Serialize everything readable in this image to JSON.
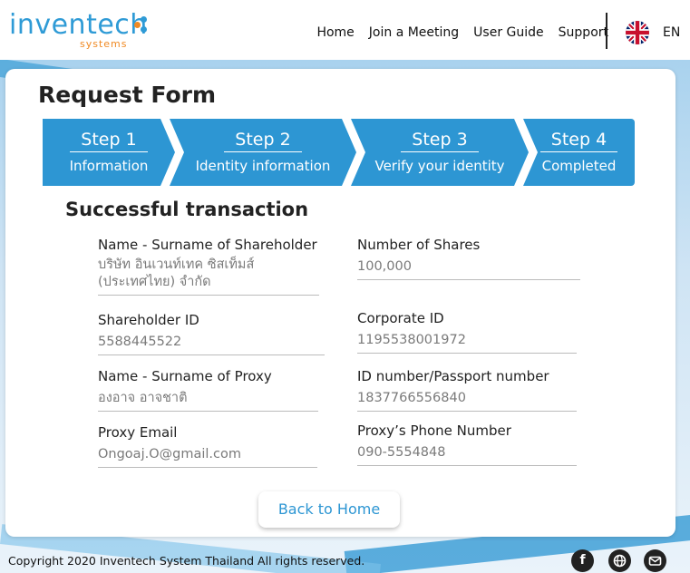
{
  "header": {
    "logo_text": "inventech",
    "logo_sub": "systems",
    "nav": [
      "Home",
      "Join a Meeting",
      "User Guide",
      "Support"
    ],
    "language": "EN"
  },
  "form": {
    "title": "Request Form",
    "steps": [
      {
        "number": "Step 1",
        "label": "Information"
      },
      {
        "number": "Step 2",
        "label": "Identity information"
      },
      {
        "number": "Step 3",
        "label": "Verify your identity"
      },
      {
        "number": "Step 4",
        "label": "Completed"
      }
    ],
    "section_title": "Successful transaction",
    "fields": {
      "shareholder_name": {
        "label": "Name - Surname of Shareholder",
        "value": "บริษัท อินเวนท์เทค ซิสเท็มส์ (ประเทศไทย) จำกัด"
      },
      "shares": {
        "label": "Number of Shares",
        "value": "100,000"
      },
      "shareholder_id": {
        "label": "Shareholder ID",
        "value": "5588445522"
      },
      "corporate_id": {
        "label": "Corporate ID",
        "value": "1195538001972"
      },
      "proxy_name": {
        "label": "Name - Surname of Proxy",
        "value": "องอาจ อาจชาติ"
      },
      "proxy_id": {
        "label": "ID number/Passport number",
        "value": "1837766556840"
      },
      "proxy_email": {
        "label": "Proxy Email",
        "value": "Ongoaj.O@gmail.com"
      },
      "proxy_phone": {
        "label": "Proxy’s Phone Number",
        "value": "090-5554848"
      }
    },
    "back_button": "Back to Home"
  },
  "footer": {
    "copyright": "Copyright  2020 Inventech System Thailand All rights reserved.",
    "social": [
      "facebook-icon",
      "globe-icon",
      "mail-icon"
    ]
  },
  "colors": {
    "accent": "#2d96d3",
    "logo_orange": "#f08a24"
  }
}
